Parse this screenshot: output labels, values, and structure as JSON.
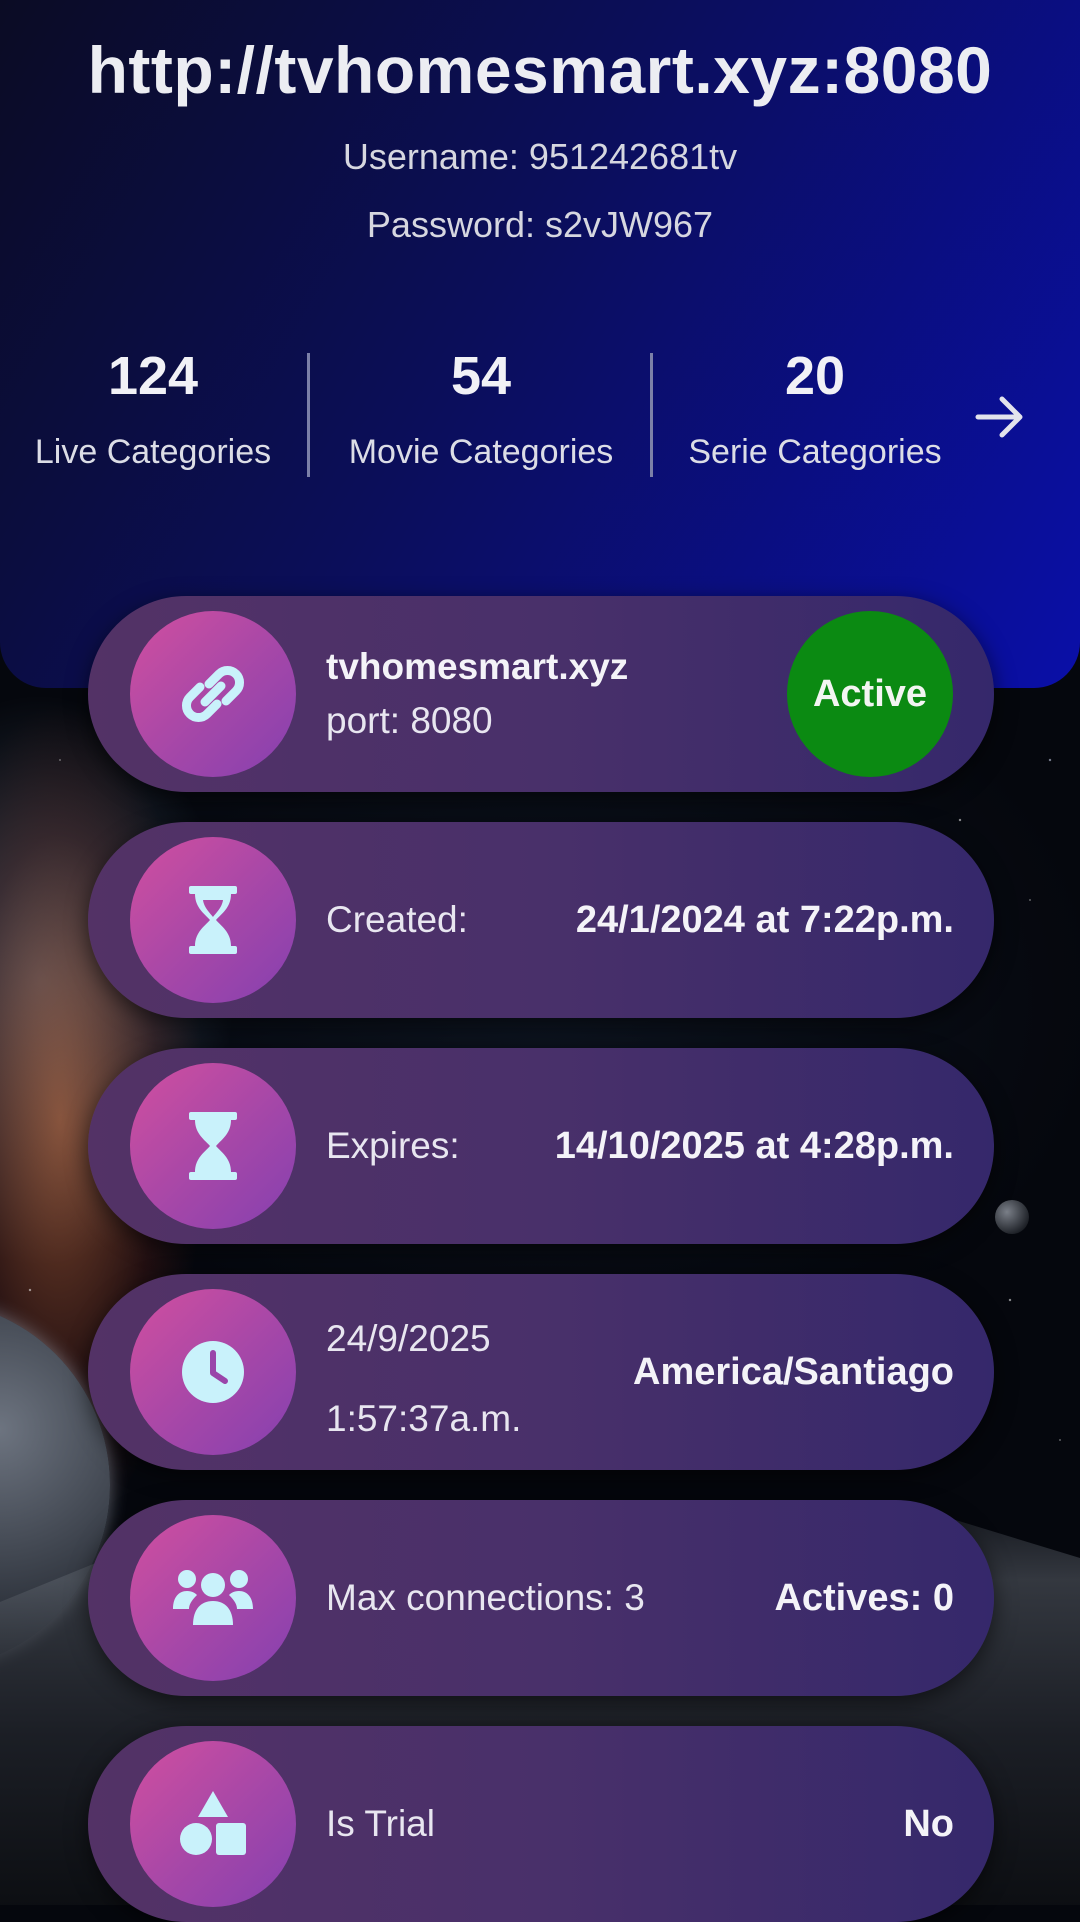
{
  "server": {
    "url": "http://tvhomesmart.xyz:8080",
    "username_label": "Username:",
    "username": "951242681tv",
    "password_label": "Password:",
    "password": "s2vJW967"
  },
  "stats": {
    "live": {
      "count": "124",
      "label": "Live Categories"
    },
    "movie": {
      "count": "54",
      "label": "Movie Categories"
    },
    "serie": {
      "count": "20",
      "label": "Serie Categories"
    }
  },
  "cards": {
    "server": {
      "host": "tvhomesmart.xyz",
      "port": "port: 8080",
      "status": "Active",
      "status_color": "#0b8a12",
      "icon": "link-icon"
    },
    "created": {
      "label": "Created:",
      "value": "24/1/2024 at 7:22p.m.",
      "icon": "hourglass-icon"
    },
    "expires": {
      "label": "Expires:",
      "value": "14/10/2025 at 4:28p.m.",
      "icon": "hourglass-icon"
    },
    "time": {
      "date": "24/9/2025",
      "clock": "1:57:37a.m.",
      "timezone": "America/Santiago",
      "icon": "clock-icon"
    },
    "connections": {
      "label": "Max connections: 3",
      "value": "Actives: 0",
      "icon": "users-icon"
    },
    "trial": {
      "label": "Is Trial",
      "value": "No",
      "icon": "shapes-icon"
    }
  },
  "colors": {
    "header_gradient_start": "#0b0c24",
    "header_gradient_end": "#0a0fa8",
    "card_gradient_start": "#533266",
    "card_gradient_end": "#35286b",
    "icon_gradient_start": "#d14f9f",
    "icon_gradient_end": "#8540b0",
    "icon_glyph": "#c9f2fb"
  }
}
